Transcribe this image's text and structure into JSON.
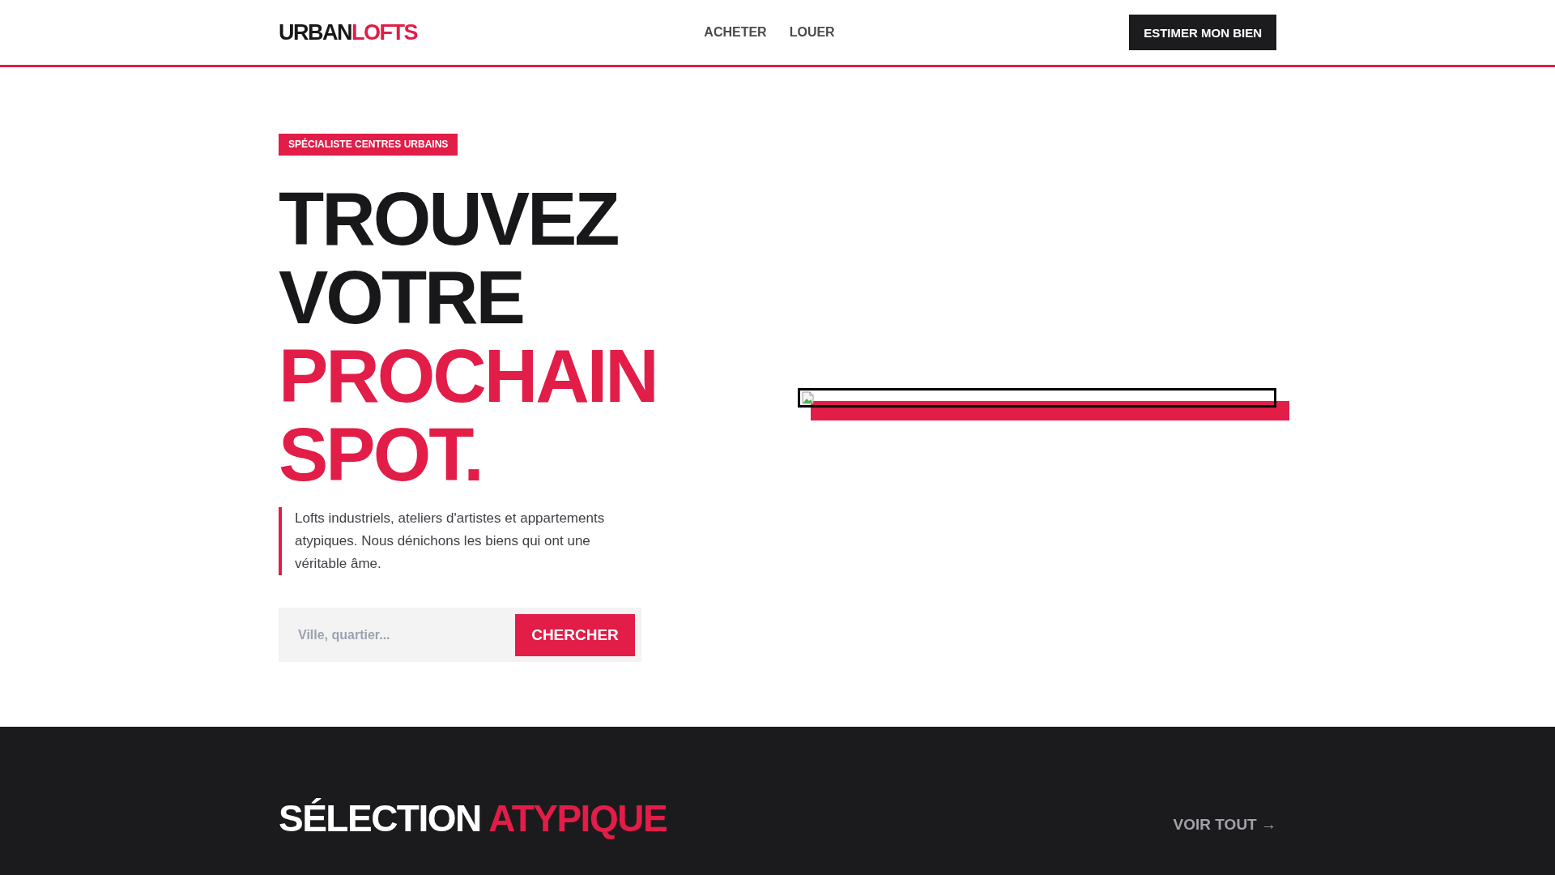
{
  "header": {
    "logo": {
      "text": "URBAN",
      "accent_text": "LOFTS"
    },
    "nav": [
      {
        "label": "ACHETER"
      },
      {
        "label": "LOUER"
      }
    ],
    "cta": "ESTIMER MON BIEN"
  },
  "hero": {
    "badge": "SPÉCIALISTE CENTRES URBAINS",
    "headline": [
      {
        "text": "TROUVEZ",
        "accent": false
      },
      {
        "text": "VOTRE",
        "accent": false
      },
      {
        "text": "PROCHAIN",
        "accent": true
      },
      {
        "text": "SPOT.",
        "accent": true
      }
    ],
    "intro": "Lofts industriels, ateliers d'artistes et appartements atypiques. Nous dénichons les biens qui ont une véritable âme.",
    "search": {
      "placeholder": "Ville, quartier...",
      "button": "CHERCHER"
    }
  },
  "selection": {
    "title": "SÉLECTION",
    "title_accent": "ATYPIQUE",
    "link": "VOIR TOUT →"
  }
}
